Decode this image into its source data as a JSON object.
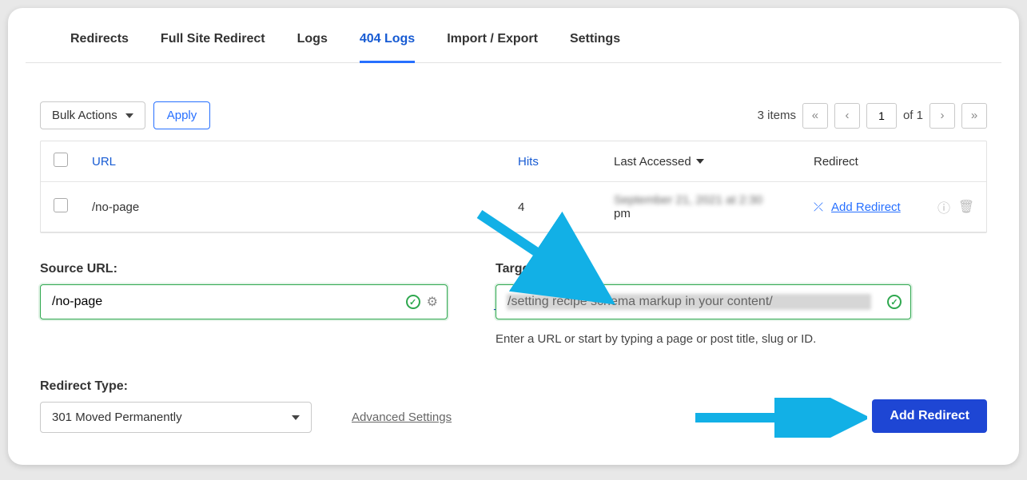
{
  "tabs": [
    {
      "label": "Redirects"
    },
    {
      "label": "Full Site Redirect"
    },
    {
      "label": "Logs"
    },
    {
      "label": "404 Logs"
    },
    {
      "label": "Import / Export"
    },
    {
      "label": "Settings"
    }
  ],
  "toolbar": {
    "bulk_label": "Bulk Actions",
    "apply_label": "Apply",
    "items_text": "3 items",
    "page_current": "1",
    "page_of_text": "of 1"
  },
  "table": {
    "headers": {
      "url": "URL",
      "hits": "Hits",
      "last_accessed": "Last Accessed",
      "redirect": "Redirect"
    },
    "rows": [
      {
        "url": "/no-page",
        "hits": "4",
        "last_accessed_line1": "September 21, 2021 at 2:30",
        "last_accessed_line2": "pm",
        "redirect_link": "Add Redirect"
      }
    ]
  },
  "form": {
    "source_label": "Source URL:",
    "source_value": "/no-page",
    "target_label": "Target URL:",
    "target_value": "/setting recipe schema markup in your content/",
    "target_hint": "Enter a URL or start by typing a page or post title, slug or ID.",
    "redirect_type_label": "Redirect Type:",
    "redirect_type_value": "301 Moved Permanently",
    "advanced_settings": "Advanced Settings",
    "submit_label": "Add Redirect"
  },
  "symbols": {
    "angle_double_left": "«",
    "angle_left": "‹",
    "angle_right": "›",
    "angle_double_right": "»",
    "shuffle": "⤫",
    "info": "ⓘ",
    "trash": "🗑",
    "gear": "⚙",
    "check": "✓",
    "arrow_right": "→"
  }
}
